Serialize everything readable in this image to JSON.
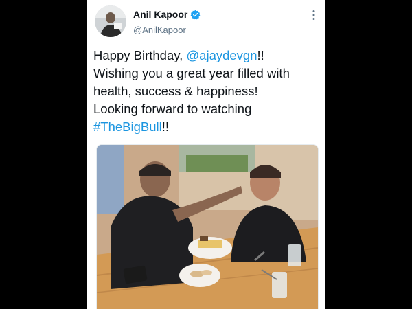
{
  "author": {
    "display_name": "Anil Kapoor",
    "handle": "@AnilKapoor",
    "verified": true,
    "avatar_icon": "profile-photo"
  },
  "tweet": {
    "line1_prefix": "Happy Birthday, ",
    "mention": "@ajaydevgn",
    "line1_suffix": "!!",
    "line2": "Wishing you a great year filled with",
    "line3": "health, success & happiness!",
    "line4": "Looking forward to watching",
    "hashtag": "#TheBigBull",
    "line5_suffix": "!!"
  },
  "colors": {
    "link": "#1b95e0",
    "verified_badge": "#1da1f2",
    "background": "#000000"
  },
  "icons": {
    "verified": "verified-badge-icon",
    "more": "more-options-icon"
  }
}
